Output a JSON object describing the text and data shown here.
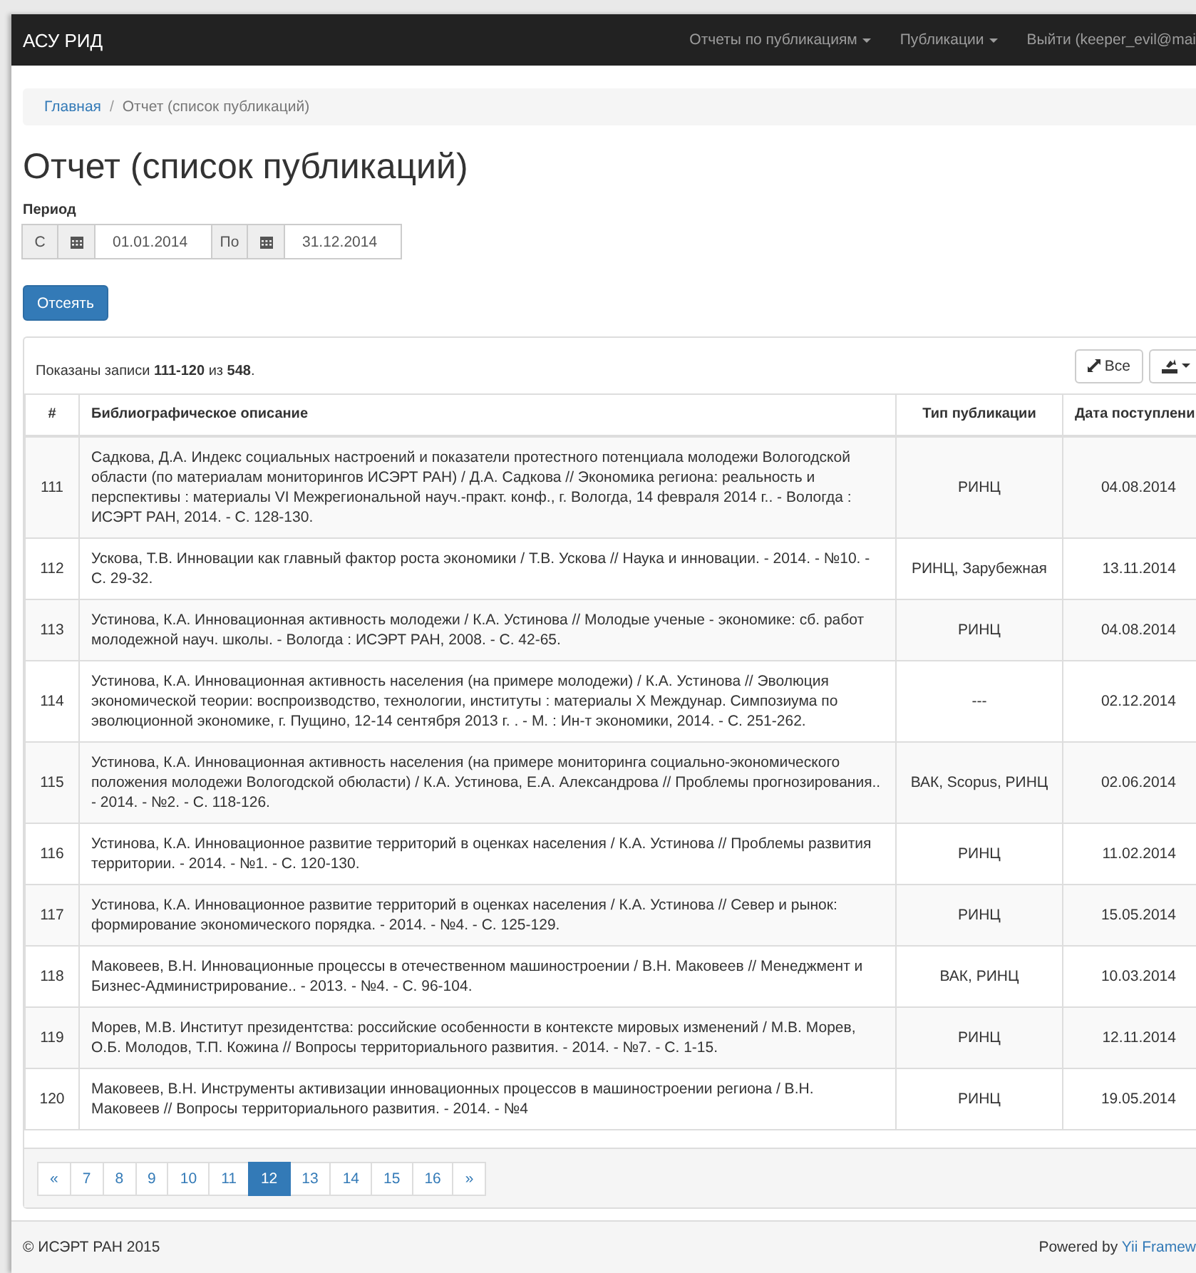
{
  "navbar": {
    "brand": "АСУ РИД",
    "items": [
      {
        "label": "Отчеты по публикациям",
        "dropdown": true
      },
      {
        "label": "Публикации",
        "dropdown": true
      },
      {
        "label": "Выйти (keeper_evil@mai",
        "dropdown": false
      }
    ]
  },
  "breadcrumb": {
    "separator": "/",
    "items": [
      {
        "label": "Главная",
        "kind": "link"
      },
      {
        "label": "Отчет (список публикаций)",
        "kind": "current"
      }
    ]
  },
  "title": "Отчет (список публикаций)",
  "period": {
    "label": "Период",
    "from_label": "С",
    "from_value": "01.01.2014",
    "to_label": "По",
    "to_value": "31.12.2014"
  },
  "filter_button": "Отсеять",
  "grid": {
    "summary": "Показаны записи **111-120** из **548**.",
    "all_button": "Все",
    "columns": [
      "#",
      "Библиографическое описание",
      "Тип публикации",
      "Дата поступлени"
    ],
    "rows": [
      {
        "number": "111",
        "description": "Садкова, Д.А. Индекс социальных настроений и показатели протестного потенциала молодежи Вологодской области (по материалам мониторингов ИСЭРТ РАН) / Д.А. Садкова // Экономика региона: реальность и перспективы : материалы VI Межрегиональной науч.-практ. конф., г. Вологда, 14 февраля 2014 г.. - Вологда : ИСЭРТ РАН, 2014. - С. 128-130.",
        "type": "РИНЦ",
        "date": "04.08.2014"
      },
      {
        "number": "112",
        "description": "Ускова, Т.В. Инновации как главный фактор роста экономики / Т.В. Ускова // Наука и инновации. - 2014. - №10. - С. 29-32.",
        "type": "РИНЦ, Зарубежная",
        "date": "13.11.2014"
      },
      {
        "number": "113",
        "description": "Устинова, К.А. Инновационная активность молодежи / К.А. Устинова // Молодые ученые - экономике: сб. работ молодежной науч. школы. - Вологда : ИСЭРТ РАН, 2008. - С. 42-65.",
        "type": "РИНЦ",
        "date": "04.08.2014"
      },
      {
        "number": "114",
        "description": "Устинова, К.А. Инновационная активность населения (на примере молодежи) / К.А. Устинова // Эволюция экономической теории: воспроизводство, технологии, институты : материалы X Междунар. Симпозиума по эволюционной экономике, г. Пущино, 12-14 сентября 2013 г. . - М. : Ин-т экономики, 2014. - С. 251-262.",
        "type": "---",
        "date": "02.12.2014"
      },
      {
        "number": "115",
        "description": "Устинова, К.А. Инновационная активность населения (на примере мониторинга социально-экономического положения молодежи Вологодской обюласти) / К.А. Устинова, Е.А. Александрова // Проблемы прогнозирования.. - 2014. - №2. - С. 118-126.",
        "type": "ВАК, Scopus, РИНЦ",
        "date": "02.06.2014"
      },
      {
        "number": "116",
        "description": "Устинова, К.А. Инновационное развитие территорий в оценках населения / К.А. Устинова // Проблемы развития территории. - 2014. - №1. - С. 120-130.",
        "type": "РИНЦ",
        "date": "11.02.2014"
      },
      {
        "number": "117",
        "description": "Устинова, К.А. Инновационное развитие территорий в оценках населения / К.А. Устинова // Север и рынок: формирование экономического порядка. - 2014. - №4. - С. 125-129.",
        "type": "РИНЦ",
        "date": "15.05.2014"
      },
      {
        "number": "118",
        "description": "Маковеев, В.Н. Инновационные процессы в отечественном машиностроении / В.Н. Маковеев // Менеджмент и Бизнес-Администрирование.. - 2013. - №4. - С. 96-104.",
        "type": "ВАК, РИНЦ",
        "date": "10.03.2014"
      },
      {
        "number": "119",
        "description": "Морев, М.В. Институт президентства: российские особенности в контексте мировых изменений / М.В. Морев, О.Б. Молодов, Т.П. Кожина // Вопросы территориального развития. - 2014. - №7. - С. 1-15.",
        "type": "РИНЦ",
        "date": "12.11.2014"
      },
      {
        "number": "120",
        "description": "Маковеев, В.Н. Инструменты активизации инновационных процессов в машиностроении региона / В.Н. Маковеев // Вопросы территориального развития. - 2014. - №4",
        "type": "РИНЦ",
        "date": "19.05.2014"
      }
    ],
    "pagination": [
      {
        "label": "«",
        "selected": false
      },
      {
        "label": "7",
        "selected": false
      },
      {
        "label": "8",
        "selected": false
      },
      {
        "label": "9",
        "selected": false
      },
      {
        "label": "10",
        "selected": false
      },
      {
        "label": "11",
        "selected": false
      },
      {
        "label": "12",
        "selected": true
      },
      {
        "label": "13",
        "selected": false
      },
      {
        "label": "14",
        "selected": false
      },
      {
        "label": "15",
        "selected": false
      },
      {
        "label": "16",
        "selected": false
      },
      {
        "label": "»",
        "selected": false
      }
    ]
  },
  "footer": {
    "copyright": "© ИСЭРТ РАН 2015",
    "powered": "Powered by",
    "link": "Yii Framew"
  }
}
